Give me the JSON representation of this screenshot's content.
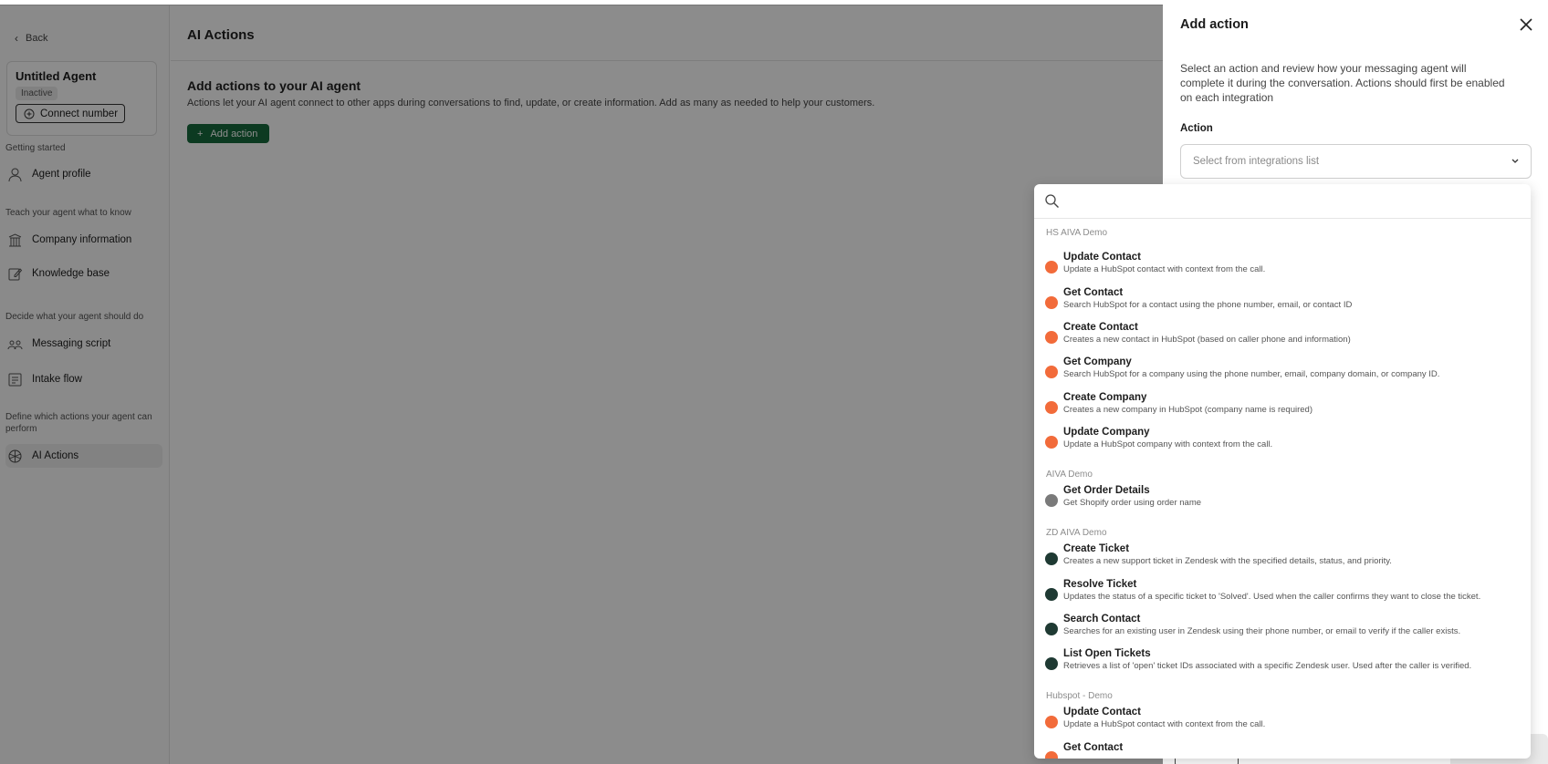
{
  "sidebar": {
    "back_label": "Back",
    "agent": {
      "name": "Untitled Agent",
      "status": "Inactive",
      "connect_label": "Connect number"
    },
    "sections": {
      "getting_started": "Getting started",
      "teach": "Teach your agent what to know",
      "decide": "Decide what your agent should do",
      "define": "Define which actions your agent can perform"
    },
    "items": {
      "agent_profile": "Agent profile",
      "company_information": "Company information",
      "knowledge_base": "Knowledge base",
      "messaging_script": "Messaging script",
      "intake_flow": "Intake flow",
      "ai_actions": "AI Actions"
    }
  },
  "main": {
    "title": "AI Actions",
    "heading": "Add actions to your AI agent",
    "description": "Actions let your AI agent connect to other apps during conversations to find, update, or create information. Add as many as needed to help your customers.",
    "add_button": "Add action"
  },
  "drawer": {
    "title": "Add action",
    "description": "Select an action and review how your messaging agent will complete it during the conversation. Actions should first be enabled on each integration",
    "field_label": "Action",
    "select_placeholder": "Select from integrations list"
  },
  "dropdown": {
    "search_value": "",
    "groups": [
      {
        "label": "HS AIVA Demo",
        "icon": "hubspot-icon",
        "items": [
          {
            "title": "Update Contact",
            "desc": "Update a HubSpot contact with context from the call."
          },
          {
            "title": "Get Contact",
            "desc": "Search HubSpot for a contact using the phone number, email, or contact ID"
          },
          {
            "title": "Create Contact",
            "desc": "Creates a new contact in HubSpot (based on caller phone and information)"
          },
          {
            "title": "Get Company",
            "desc": "Search HubSpot for a company using the phone number, email, company domain, or company ID."
          },
          {
            "title": "Create Company",
            "desc": "Creates a new company in HubSpot (company name is required)"
          },
          {
            "title": "Update Company",
            "desc": "Update a HubSpot company with context from the call."
          }
        ]
      },
      {
        "label": "AIVA Demo",
        "icon": "shopify-icon",
        "items": [
          {
            "title": "Get Order Details",
            "desc": "Get Shopify order using order name"
          }
        ]
      },
      {
        "label": "ZD AIVA Demo",
        "icon": "zendesk-icon",
        "items": [
          {
            "title": "Create Ticket",
            "desc": "Creates a new support ticket in Zendesk with the specified details, status, and priority."
          },
          {
            "title": "Resolve Ticket",
            "desc": "Updates the status of a specific ticket to 'Solved'. Used when the caller confirms they want to close the ticket."
          },
          {
            "title": "Search Contact",
            "desc": "Searches for an existing user in Zendesk using their phone number, or email to verify if the caller exists."
          },
          {
            "title": "List Open Tickets",
            "desc": "Retrieves a list of 'open' ticket IDs associated with a specific Zendesk user. Used after the caller is verified."
          }
        ]
      },
      {
        "label": "Hubspot - Demo",
        "icon": "hubspot-icon",
        "items": [
          {
            "title": "Update Contact",
            "desc": "Update a HubSpot contact with context from the call."
          },
          {
            "title": "Get Contact",
            "desc": ""
          }
        ]
      }
    ]
  },
  "colors": {
    "accent": "#176b3c",
    "hubspot": "#f26b3a",
    "zendesk": "#1f3a33",
    "shopify": "#7a7a7a"
  }
}
